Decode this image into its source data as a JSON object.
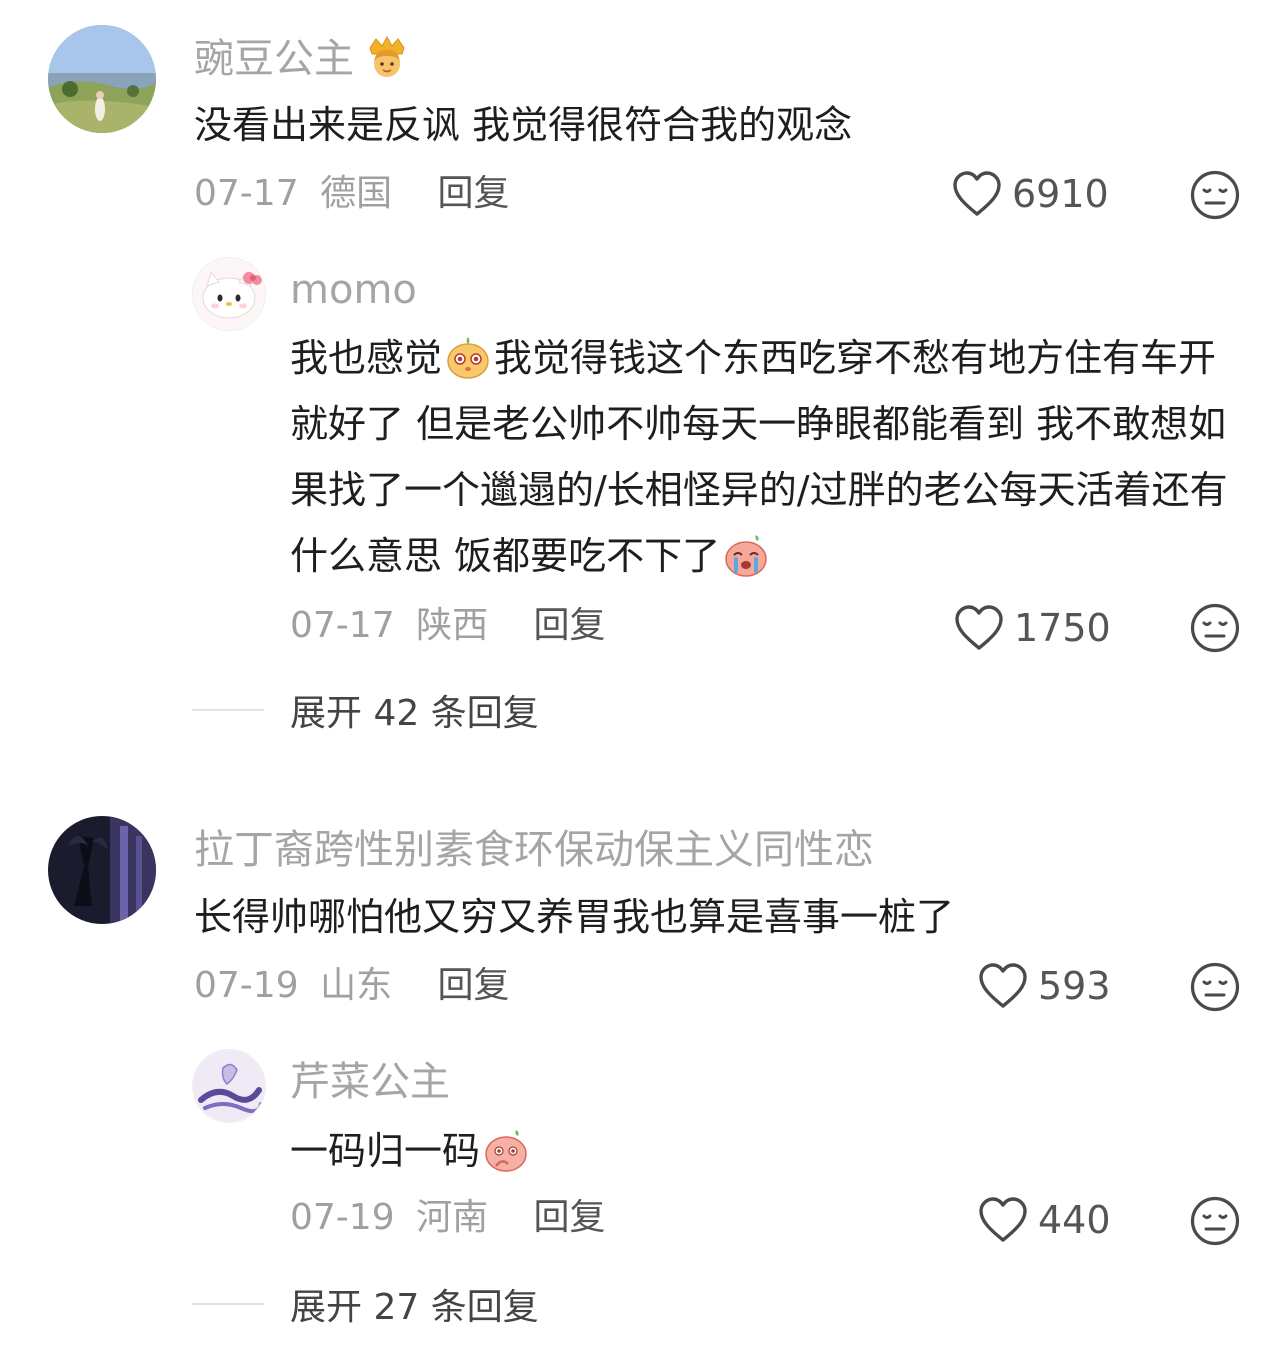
{
  "comments": [
    {
      "name": "豌豆公主",
      "text": "没看出来是反讽 我觉得很符合我的观念",
      "date": "07-17",
      "location": "德国",
      "reply_label": "回复",
      "likes": "6910",
      "replies": [
        {
          "name": "momo",
          "text_parts": [
            "我也感觉",
            "我觉得钱这个东西吃穿不愁有地方住有车开就好了 但是老公帅不帅每天一睁眼都能看到 我不敢想如果找了一个邋遢的/长相怪异的/过胖的老公每天活着还有什么意思 饭都要吃不下了"
          ],
          "date": "07-17",
          "location": "陕西",
          "reply_label": "回复",
          "likes": "1750"
        }
      ],
      "expand_label": "展开 42 条回复"
    },
    {
      "name": "拉丁裔跨性别素食环保动保主义同性恋",
      "text": "长得帅哪怕他又穷又养胃我也算是喜事一桩了",
      "date": "07-19",
      "location": "山东",
      "reply_label": "回复",
      "likes": "593",
      "replies": [
        {
          "name": "芹菜公主",
          "text": "一码归一码",
          "date": "07-19",
          "location": "河南",
          "reply_label": "回复",
          "likes": "440"
        }
      ],
      "expand_label": "展开 27 条回复"
    }
  ],
  "icons": {
    "like": "heart-outline-icon",
    "dislike": "meh-face-icon",
    "crown": "princess-emoji",
    "sticker": "peach-face-sticker"
  },
  "colors": {
    "name": "#a5a5a5",
    "text": "#1e1e1e",
    "meta": "#a0a0a0",
    "action": "#555555"
  }
}
